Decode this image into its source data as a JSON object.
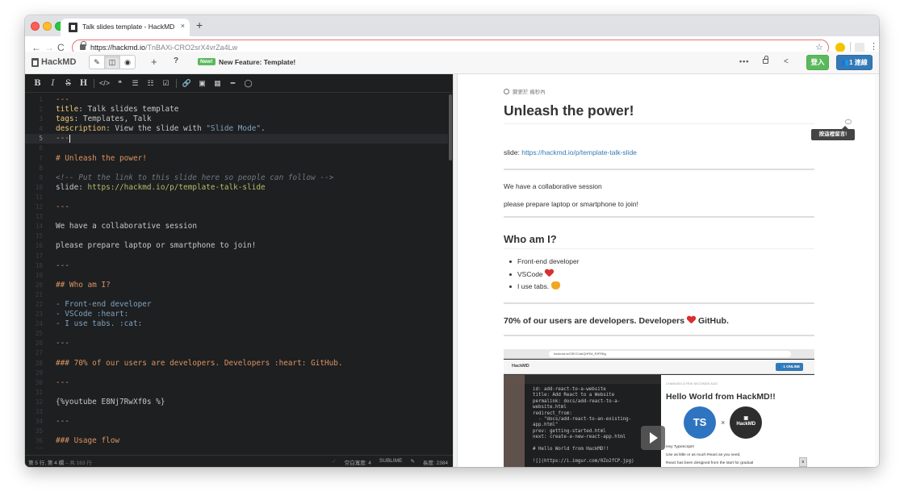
{
  "browser": {
    "tab_title": "Talk slides template - HackMD",
    "tab_close": "×",
    "new_tab": "+",
    "back": "←",
    "forward": "→",
    "reload": "C",
    "url_host": "https://hackmd.io",
    "url_path": "/TnBAXi-CRO2srX4vrZa4Lw",
    "star": "☆",
    "menu": "⋮"
  },
  "hackmd_nav": {
    "brand": "HackMD",
    "modes": [
      "✎",
      "◫",
      "◉"
    ],
    "plus": "+",
    "help": "?",
    "new_badge": "New!",
    "new_feature": "New Feature: Template!",
    "more": "•••",
    "share": "<",
    "login": "登入",
    "online": "👥1 連線"
  },
  "editor_toolbar": [
    "B",
    "I",
    "S",
    "H",
    "</>",
    "❝",
    "☰",
    "☷",
    "☑",
    "🔗",
    "▣",
    "▦",
    "━",
    "◯"
  ],
  "editor_lines": [
    {
      "n": "1",
      "segs": [
        {
          "t": "---",
          "c": "org"
        }
      ]
    },
    {
      "n": "2",
      "segs": [
        {
          "t": "title",
          "c": "key"
        },
        {
          "t": ": Talk slides template",
          "c": ""
        }
      ]
    },
    {
      "n": "3",
      "segs": [
        {
          "t": "tags",
          "c": "key"
        },
        {
          "t": ": Templates, Talk",
          "c": ""
        }
      ]
    },
    {
      "n": "4",
      "segs": [
        {
          "t": "description",
          "c": "key"
        },
        {
          "t": ": View the slide with ",
          "c": ""
        },
        {
          "t": "\"Slide Mode\"",
          "c": "str"
        },
        {
          "t": ".",
          "c": ""
        }
      ]
    },
    {
      "n": "5",
      "segs": [
        {
          "t": "---",
          "c": "org"
        }
      ],
      "active": true
    },
    {
      "n": "6",
      "segs": []
    },
    {
      "n": "7",
      "segs": [
        {
          "t": "# Unleash the power!",
          "c": "org"
        }
      ]
    },
    {
      "n": "8",
      "segs": []
    },
    {
      "n": "9",
      "segs": [
        {
          "t": "<!-- Put the link to this slide here so people can follow -->",
          "c": "cmt"
        }
      ]
    },
    {
      "n": "10",
      "segs": [
        {
          "t": "slide: ",
          "c": ""
        },
        {
          "t": "https://hackmd.io/p/template-talk-slide",
          "c": "grn"
        }
      ]
    },
    {
      "n": "11",
      "segs": []
    },
    {
      "n": "12",
      "segs": [
        {
          "t": "---",
          "c": "org"
        }
      ]
    },
    {
      "n": "13",
      "segs": []
    },
    {
      "n": "14",
      "segs": [
        {
          "t": "We have a collaborative session",
          "c": ""
        }
      ]
    },
    {
      "n": "15",
      "segs": []
    },
    {
      "n": "16",
      "segs": [
        {
          "t": "please prepare laptop or smartphone to join!",
          "c": ""
        }
      ]
    },
    {
      "n": "17",
      "segs": []
    },
    {
      "n": "18",
      "segs": [
        {
          "t": "---",
          "c": "org"
        }
      ]
    },
    {
      "n": "19",
      "segs": []
    },
    {
      "n": "20",
      "segs": [
        {
          "t": "## Who am I?",
          "c": "org"
        }
      ]
    },
    {
      "n": "21",
      "segs": []
    },
    {
      "n": "22",
      "segs": [
        {
          "t": "- Front-end developer",
          "c": "blue"
        }
      ]
    },
    {
      "n": "23",
      "segs": [
        {
          "t": "- VSCode :heart:",
          "c": "blue"
        }
      ]
    },
    {
      "n": "24",
      "segs": [
        {
          "t": "- I use tabs. :cat:",
          "c": "blue"
        }
      ]
    },
    {
      "n": "25",
      "segs": []
    },
    {
      "n": "26",
      "segs": [
        {
          "t": "---",
          "c": "org"
        }
      ]
    },
    {
      "n": "27",
      "segs": []
    },
    {
      "n": "28",
      "segs": [
        {
          "t": "### 70% of our users are developers. Developers :heart: GitHub.",
          "c": "org"
        }
      ]
    },
    {
      "n": "29",
      "segs": []
    },
    {
      "n": "30",
      "segs": [
        {
          "t": "---",
          "c": "org"
        }
      ]
    },
    {
      "n": "31",
      "segs": []
    },
    {
      "n": "32",
      "segs": [
        {
          "t": "{%youtube E8Nj7RwXf0s %}",
          "c": ""
        }
      ]
    },
    {
      "n": "33",
      "segs": []
    },
    {
      "n": "34",
      "segs": [
        {
          "t": "---",
          "c": "org"
        }
      ]
    },
    {
      "n": "35",
      "segs": []
    },
    {
      "n": "36",
      "segs": [
        {
          "t": "### Usage flow",
          "c": "org"
        }
      ]
    },
    {
      "n": "37",
      "segs": []
    }
  ],
  "status_bar": {
    "position": "第 5 行, 第 4 欄",
    "total": "– 共 163 行",
    "indent": "空白寬度: 4",
    "keymap": "SUBLIME",
    "length": "長度: 2384"
  },
  "preview": {
    "changed": "變更於 幾秒內",
    "h1": "Unleash the power!",
    "slide_label": "slide: ",
    "slide_link": "https://hackmd.io/p/template-talk-slide",
    "p1": "We have a collaborative session",
    "p2": "please prepare laptop or smartphone to join!",
    "h2": "Who am I?",
    "li1": "Front-end developer",
    "li2": "VSCode",
    "li3": "I use tabs.",
    "h3_pre": "70% of our users are developers. Developers",
    "h3_post": "GitHub.",
    "tooltip": "按這裡留言!"
  },
  "video": {
    "url": "hackmd.io/OBYC/ahQHRM_RIFRBg",
    "brand": "HackMD",
    "online": "👥1 ONLINE",
    "code": "id: add-react-to-a-website\ntitle: Add React to a Website\npermalink: docs/add-react-to-a-\nwebsite.html\nredirect_from:\n  - \"docs/add-react-to-an-existing-\napp.html\"\nprev: getting-started.html\nnext: create-a-new-react-app.html\n\n# Hello World from HackMD!!\n\n![](https://i.imgur.com/0Zo2fCP.jpg)",
    "top": "CHANGED A FEW SECONDS AGO",
    "title": "Hello World from HackMD!!",
    "ts": "TS",
    "x": "×",
    "hmd_text": "HackMD",
    "p1": "Hey TypeScript!!",
    "p2": "Use as little or as much React as you need.",
    "p3": "React has been designed from the start for gradual"
  },
  "colors": {
    "green": "#5cb85c",
    "blue": "#337ab7",
    "editor_bg": "#1d1f21",
    "heart": "#d8302f"
  }
}
